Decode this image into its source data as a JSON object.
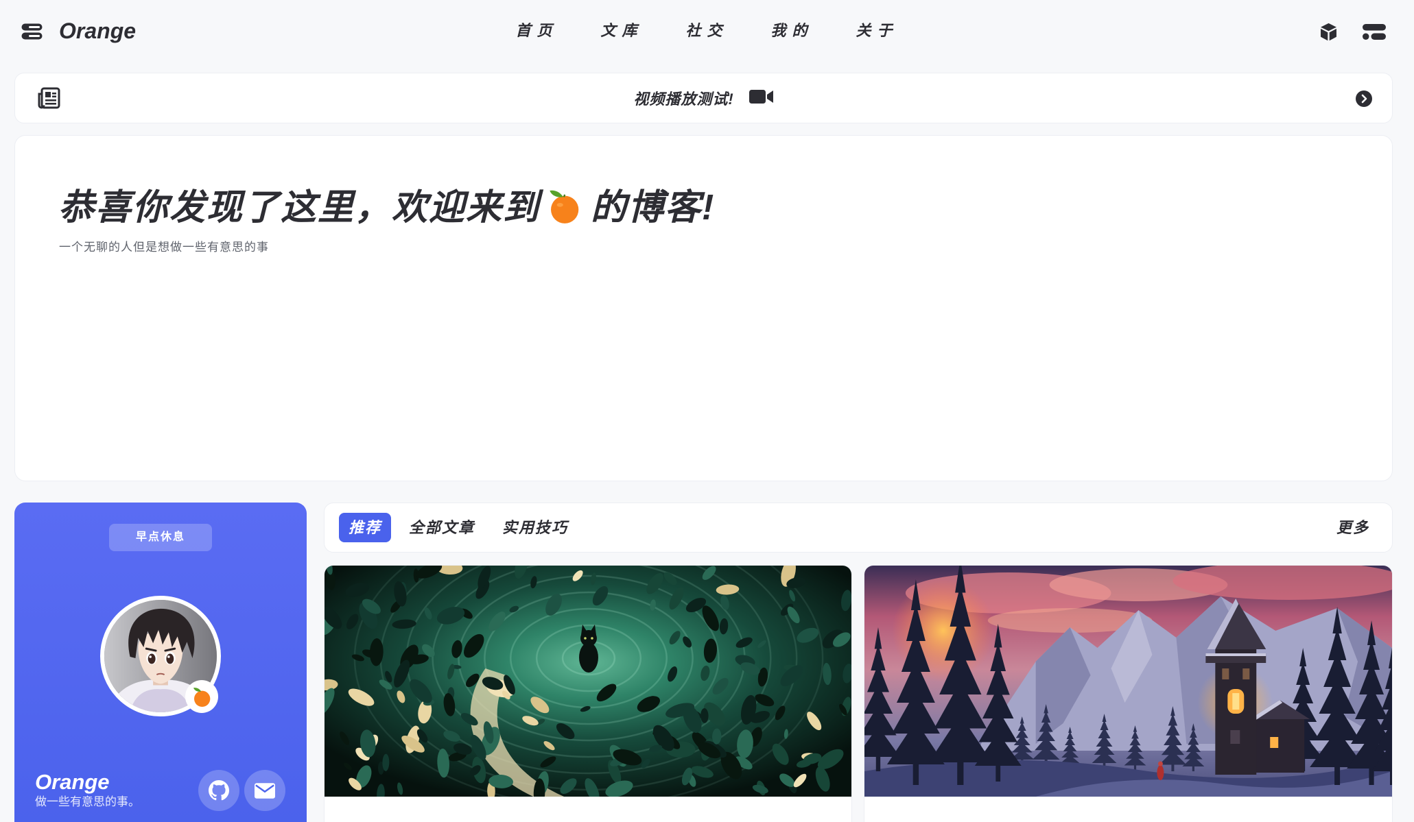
{
  "colors": {
    "accent": "#4a62ec",
    "text": "#2d2d33",
    "muted": "#5f636c",
    "orange": "#f7821b",
    "leaf": "#58a22b"
  },
  "header": {
    "logo_icon": "server-icon",
    "brand": "Orange",
    "nav": [
      {
        "label": "首页"
      },
      {
        "label": "文库"
      },
      {
        "label": "社交"
      },
      {
        "label": "我的"
      },
      {
        "label": "关于"
      }
    ],
    "actions": [
      {
        "icon": "cube-icon"
      },
      {
        "icon": "menu-icon"
      }
    ]
  },
  "announcement": {
    "icon": "newspaper-icon",
    "text": "视频播放测试!",
    "text_icon": "video-camera-icon",
    "next_icon": "arrow-right-circle-icon"
  },
  "hero": {
    "title_part1": "恭喜你发现了这里，欢迎来到",
    "title_icon": "orange-icon",
    "title_part2": "的博客!",
    "subtitle": "一个无聊的人但是想做一些有意思的事"
  },
  "profile": {
    "status": "早点休息",
    "name": "Orange",
    "bio": "做一些有意思的事。",
    "badge_icon": "orange-icon",
    "links": [
      {
        "icon": "github-icon"
      },
      {
        "icon": "mail-icon"
      }
    ]
  },
  "posts_nav": {
    "tabs": [
      {
        "label": "推荐",
        "active": true
      },
      {
        "label": "全部文章",
        "active": false
      },
      {
        "label": "实用技巧",
        "active": false
      }
    ],
    "more": "更多"
  }
}
